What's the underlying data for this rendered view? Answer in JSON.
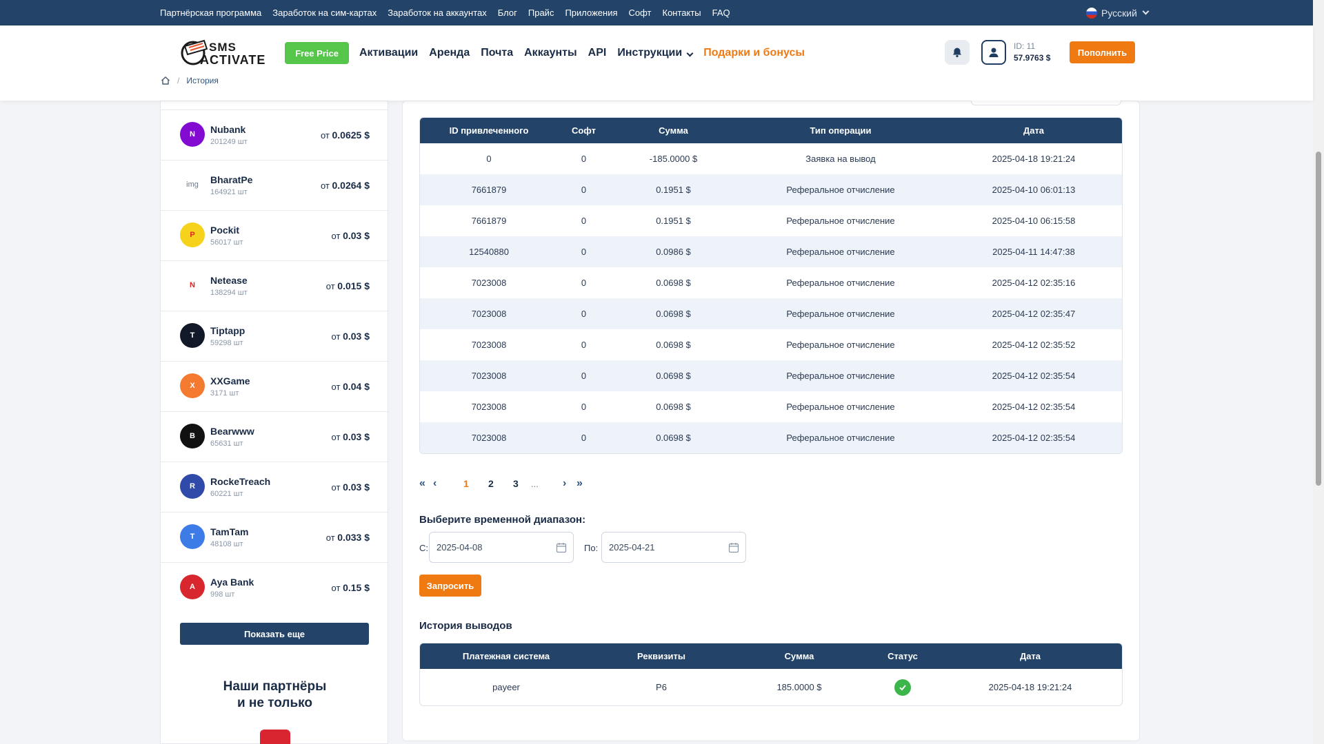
{
  "topbar": {
    "links": [
      "Партнёрская программа",
      "Заработок на сим-картах",
      "Заработок на аккаунтах",
      "Блог",
      "Прайс",
      "Приложения",
      "Софт",
      "Контакты",
      "FAQ"
    ],
    "language": "Русский"
  },
  "header": {
    "logo_line1": "SMS",
    "logo_line2": "ACTIVATE",
    "free_price": "Free Price",
    "nav": [
      "Активации",
      "Аренда",
      "Почта",
      "Аккаунты",
      "API",
      "Инструкции"
    ],
    "bonus": "Подарки и бонусы",
    "account_id": "ID: 11",
    "balance": "57.9763 $",
    "topup": "Пополнить"
  },
  "breadcrumb": {
    "current": "История"
  },
  "services": [
    {
      "name": "Nubank",
      "count": "201249 шт",
      "price_prefix": "от",
      "price": "0.0625 $",
      "color": "#820ad1",
      "icon": "nubank-icon"
    },
    {
      "name": "BharatPe",
      "count": "164921 шт",
      "price_prefix": "от",
      "price": "0.0264 $",
      "color": "#ffffff",
      "icon": "broken-image-icon",
      "alt": "img"
    },
    {
      "name": "Pockit",
      "count": "56017 шт",
      "price_prefix": "от",
      "price": "0.03 $",
      "color": "#f7d21c",
      "icon": "pockit-icon"
    },
    {
      "name": "Netease",
      "count": "138294 шт",
      "price_prefix": "от",
      "price": "0.015 $",
      "color": "#ffffff",
      "icon": "netease-icon"
    },
    {
      "name": "Tiptapp",
      "count": "59298 шт",
      "price_prefix": "от",
      "price": "0.03 $",
      "color": "#111827",
      "icon": "tiptapp-icon"
    },
    {
      "name": "XXGame",
      "count": "3171 шт",
      "price_prefix": "от",
      "price": "0.04 $",
      "color": "#f47a2f",
      "icon": "xxgame-icon"
    },
    {
      "name": "Bearwww",
      "count": "65631 шт",
      "price_prefix": "от",
      "price": "0.03 $",
      "color": "#111111",
      "icon": "bearwww-icon"
    },
    {
      "name": "RockeTreach",
      "count": "60221 шт",
      "price_prefix": "от",
      "price": "0.03 $",
      "color": "#2f4aa8",
      "icon": "rocket-icon"
    },
    {
      "name": "TamTam",
      "count": "48108 шт",
      "price_prefix": "от",
      "price": "0.033 $",
      "color": "#3d7be6",
      "icon": "tamtam-icon"
    },
    {
      "name": "Aya Bank",
      "count": "998 шт",
      "price_prefix": "от",
      "price": "0.15 $",
      "color": "#d7262e",
      "icon": "ayabank-icon"
    }
  ],
  "show_more": "Показать еще",
  "partners": {
    "line1": "Наши партнёры",
    "line2": "и не только"
  },
  "referral_table": {
    "headers": [
      "ID привлеченного",
      "Софт",
      "Сумма",
      "Тип операции",
      "Дата"
    ],
    "rows": [
      [
        "0",
        "0",
        "-185.0000 $",
        "Заявка на вывод",
        "2025-04-18 19:21:24"
      ],
      [
        "7661879",
        "0",
        "0.1951 $",
        "Реферальное отчисление",
        "2025-04-10 06:01:13"
      ],
      [
        "7661879",
        "0",
        "0.1951 $",
        "Реферальное отчисление",
        "2025-04-10 06:15:58"
      ],
      [
        "12540880",
        "0",
        "0.0986 $",
        "Реферальное отчисление",
        "2025-04-11 14:47:38"
      ],
      [
        "7023008",
        "0",
        "0.0698 $",
        "Реферальное отчисление",
        "2025-04-12 02:35:16"
      ],
      [
        "7023008",
        "0",
        "0.0698 $",
        "Реферальное отчисление",
        "2025-04-12 02:35:47"
      ],
      [
        "7023008",
        "0",
        "0.0698 $",
        "Реферальное отчисление",
        "2025-04-12 02:35:52"
      ],
      [
        "7023008",
        "0",
        "0.0698 $",
        "Реферальное отчисление",
        "2025-04-12 02:35:54"
      ],
      [
        "7023008",
        "0",
        "0.0698 $",
        "Реферальное отчисление",
        "2025-04-12 02:35:54"
      ],
      [
        "7023008",
        "0",
        "0.0698 $",
        "Реферальное отчисление",
        "2025-04-12 02:35:54"
      ]
    ]
  },
  "pagination": {
    "pages": [
      "1",
      "2",
      "3"
    ],
    "current": "1",
    "ellipsis": "..."
  },
  "date_range": {
    "title": "Выберите временной диапазон:",
    "from_label": "С:",
    "from_value": "2025-04-08",
    "to_label": "По:",
    "to_value": "2025-04-21",
    "submit": "Запросить"
  },
  "withdrawals": {
    "title": "История выводов",
    "headers": [
      "Платежная система",
      "Реквизиты",
      "Сумма",
      "Статус",
      "Дата"
    ],
    "rows": [
      {
        "system": "payeer",
        "details": "P6",
        "amount": "185.0000 $",
        "status": "success-check-icon",
        "date": "2025-04-18 19:21:24"
      }
    ]
  },
  "colors": {
    "primary": "#234468",
    "accent": "#f07a12",
    "free_price": "#55c64a",
    "success": "#3cb54a"
  }
}
